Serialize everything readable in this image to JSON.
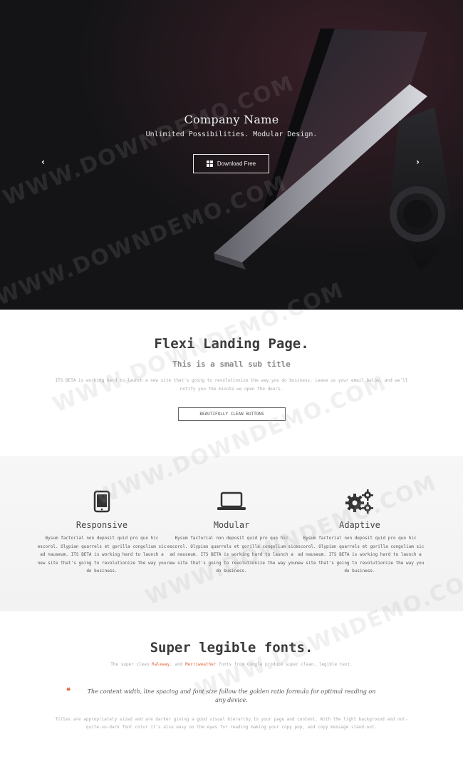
{
  "hero": {
    "title": "Company Name",
    "subtitle": "Unlimited Possibilities. Modular Design.",
    "download_label": "Download Free",
    "prev_arrow": "‹",
    "next_arrow": "›"
  },
  "intro": {
    "title": "Flexi Landing Page.",
    "subtitle": "This is a small sub title",
    "body": "ITS BETA is working hard to launch a new site that's going to revolutionize the way you do business. Leave us your email below, and we'll notify you the minute we open the doors.",
    "button_label": "BEAUTIFULLY CLEAN BUTTONS"
  },
  "features": [
    {
      "icon": "tablet-icon",
      "title": "Responsive",
      "body": "Bysum factorial non deposit quid pro quo hic escorol. Olypian quarrels et gorilla congolium sic ad nauseum. ITS BETA is working hard to launch a new site that's going to revolutionize the way you do business."
    },
    {
      "icon": "laptop-icon",
      "title": "Modular",
      "body": "Bysum factorial non deposit quid pro quo hic escorol. Olypian quarrels et gorilla congolium sic ad nauseum. ITS BETA is working hard to launch a new site that's going to revolutionize the way you do business."
    },
    {
      "icon": "gears-icon",
      "title": "Adaptive",
      "body": "Bysum factorial non deposit quid pro quo hic escorol. Olypian quarrels et gorilla congolium sic ad nauseum. ITS BETA is working hard to launch a new site that's going to revolutionize the way you do business."
    }
  ],
  "fonts_section": {
    "title": "Super legible fonts.",
    "sub_prefix": "The super clean ",
    "font1": "Raleway",
    "sub_middle": ", and ",
    "font2": "Merriweather",
    "sub_suffix": " fonts from Google produce super clean, legible text.",
    "quote_mark": "❝",
    "quote": "The content width, line spacing and font size follow the golden ratio formula for optimal reading on any device.",
    "body": "Titles are appropriately sized and are darker giving a good visual hierarchy to your page and content. With the light background and not-quite-so-dark font color it's also easy on the eyes for reading making your copy pop, and copy message stand-out."
  },
  "watermark": "WWW.DOWNDEMO.COM",
  "colors": {
    "hero_bg": "#141416",
    "accent": "#e0643b",
    "features_bg": "#f5f5f5"
  }
}
